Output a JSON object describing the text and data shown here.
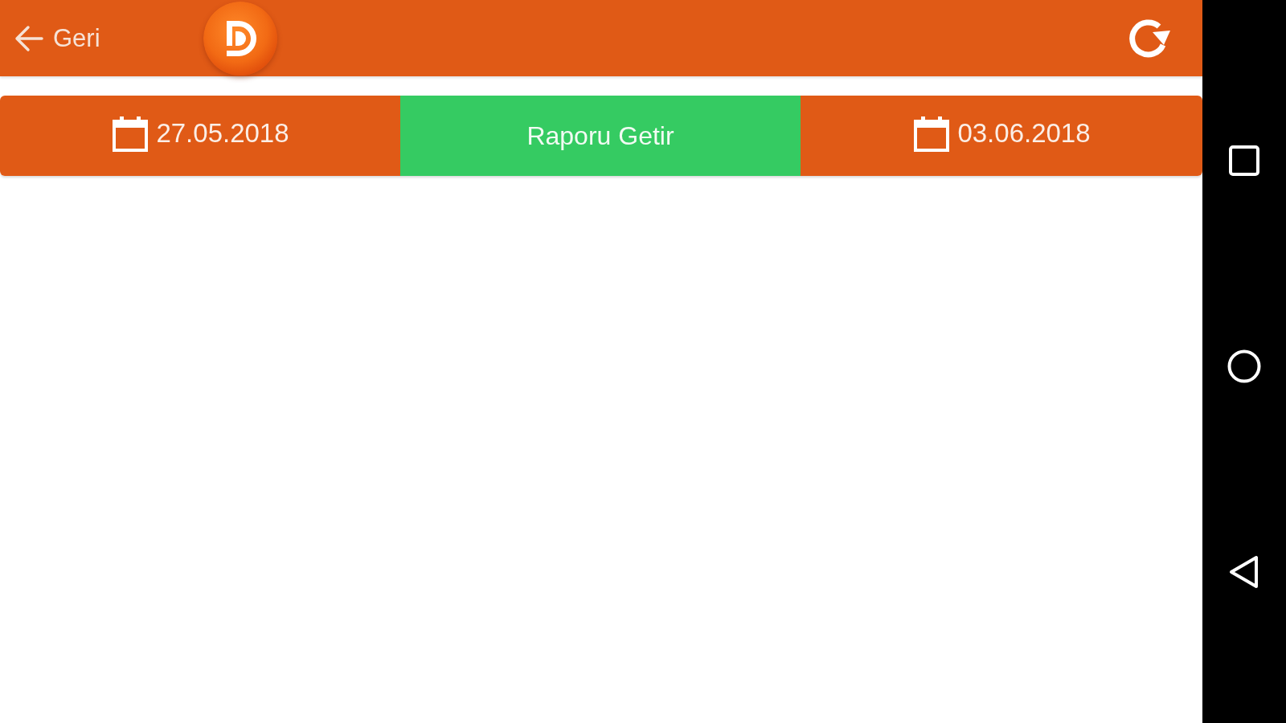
{
  "header": {
    "back_label": "Geri"
  },
  "date_bar": {
    "segments": [
      {
        "kind": "date",
        "label": "27.05.2018"
      },
      {
        "kind": "action",
        "label": "Raporu Getir"
      },
      {
        "kind": "date",
        "label": "03.06.2018"
      }
    ]
  }
}
